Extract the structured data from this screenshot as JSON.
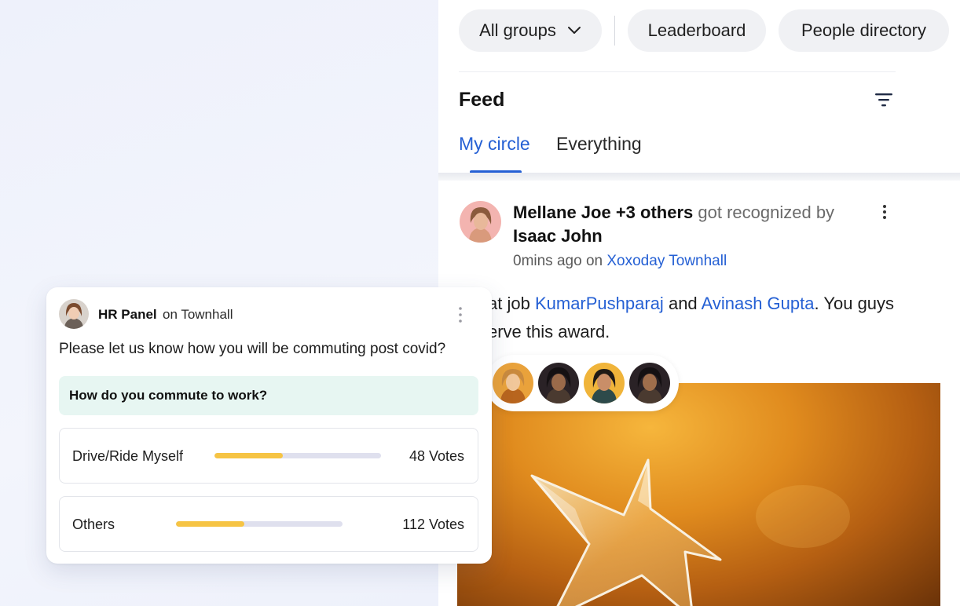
{
  "nav": {
    "groups_label": "All groups",
    "leaderboard_label": "Leaderboard",
    "people_label": "People directory"
  },
  "feed": {
    "title": "Feed",
    "tabs": [
      {
        "label": "My circle",
        "active": true
      },
      {
        "label": "Everything",
        "active": false
      }
    ]
  },
  "post": {
    "recipients": "Mellane Joe +3 others",
    "action_text": "got recognized by",
    "giver": "Isaac John",
    "time": "0mins ago",
    "on_text": "on",
    "group": "Xoxoday Townhall",
    "message_prefix": "at job",
    "mention1": "KumarPushparaj",
    "message_and": "and",
    "mention2": "Avinash Gupta",
    "message_suffix": ". You guys",
    "message_line2": "erve this award."
  },
  "poll": {
    "author": "HR Panel",
    "on_text": "on Townhall",
    "question": "Please let us know how you will be commuting post covid?",
    "poll_title": "How do you commute to work?",
    "options": [
      {
        "label": "Drive/Ride Myself",
        "votes": "48 Votes",
        "fraction": 0.41
      },
      {
        "label": "Others",
        "votes": "112 Votes",
        "fraction": 0.41
      }
    ]
  },
  "colors": {
    "accent": "#2560d4",
    "poll_bar_fill": "#f6c444",
    "poll_box_bg": "#e7f6f2"
  }
}
